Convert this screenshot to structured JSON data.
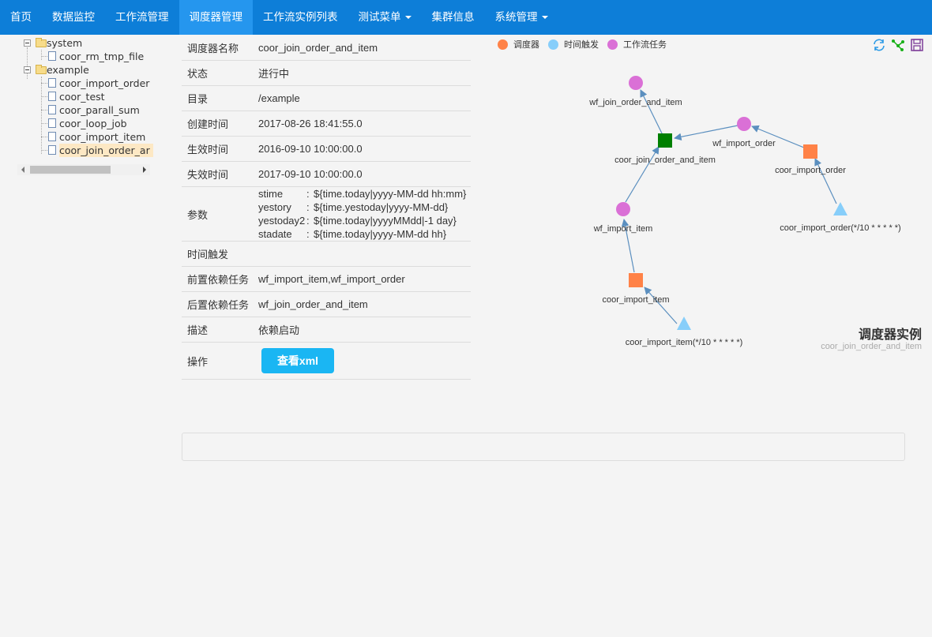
{
  "nav": {
    "items": [
      {
        "label": "首页",
        "active": false,
        "caret": false
      },
      {
        "label": "数据监控",
        "active": false,
        "caret": false
      },
      {
        "label": "工作流管理",
        "active": false,
        "caret": false
      },
      {
        "label": "调度器管理",
        "active": true,
        "caret": false
      },
      {
        "label": "工作流实例列表",
        "active": false,
        "caret": false
      },
      {
        "label": "测试菜单",
        "active": false,
        "caret": true
      },
      {
        "label": "集群信息",
        "active": false,
        "caret": false
      },
      {
        "label": "系统管理",
        "active": false,
        "caret": true
      }
    ]
  },
  "tree": {
    "folders": [
      {
        "label": "system",
        "files": [
          "coor_rm_tmp_file"
        ]
      },
      {
        "label": "example",
        "files": [
          "coor_import_order",
          "coor_test",
          "coor_parall_sum",
          "coor_loop_job",
          "coor_import_item",
          "coor_join_order_ar"
        ]
      }
    ],
    "selected": "coor_join_order_ar"
  },
  "detail": {
    "name_label": "调度器名称",
    "name_value": "coor_join_order_and_item",
    "status_label": "状态",
    "status_value": "进行中",
    "dir_label": "目录",
    "dir_value": "/example",
    "created_label": "创建时间",
    "created_value": "2017-08-26 18:41:55.0",
    "effective_label": "生效时间",
    "effective_value": "2016-09-10 10:00:00.0",
    "expire_label": "失效时间",
    "expire_value": "2017-09-10 10:00:00.0",
    "params_label": "参数",
    "params": [
      {
        "name": "stime",
        "value": "${time.today|yyyy-MM-dd hh:mm}"
      },
      {
        "name": "yestory",
        "value": "${time.yestoday|yyyy-MM-dd}"
      },
      {
        "name": "yestoday2",
        "value": "${time.today|yyyyMMdd|-1 day}"
      },
      {
        "name": "stadate",
        "value": "${time.today|yyyy-MM-dd hh}"
      }
    ],
    "time_trigger_label": "时间触发",
    "time_trigger_value": "",
    "pre_label": "前置依赖任务",
    "pre_value": "wf_import_item,wf_import_order",
    "post_label": "后置依赖任务",
    "post_value": "wf_join_order_and_item",
    "desc_label": "描述",
    "desc_value": "依赖启动",
    "op_label": "操作",
    "view_xml_button": "查看xml"
  },
  "legend": [
    {
      "label": "调度器",
      "color": "#ff8247"
    },
    {
      "label": "时间触发",
      "color": "#87cefa"
    },
    {
      "label": "工作流任务",
      "color": "#da70d6"
    }
  ],
  "tools": [
    "refresh-icon",
    "graph-layout-icon",
    "save-icon"
  ],
  "graph": {
    "title": "调度器实例",
    "subtitle": "coor_join_order_and_item",
    "labels": {
      "wf_join": "wf_join_order_and_item",
      "wf_import_order": "wf_import_order",
      "coor_join": "coor_join_order_and_item",
      "coor_import_order": "coor_import_order",
      "wf_import_item": "wf_import_item",
      "trig_order": "coor_import_order(*/10 * * * * *)",
      "coor_import_item": "coor_import_item",
      "trig_item": "coor_import_item(*/10 * * * * *)"
    }
  }
}
